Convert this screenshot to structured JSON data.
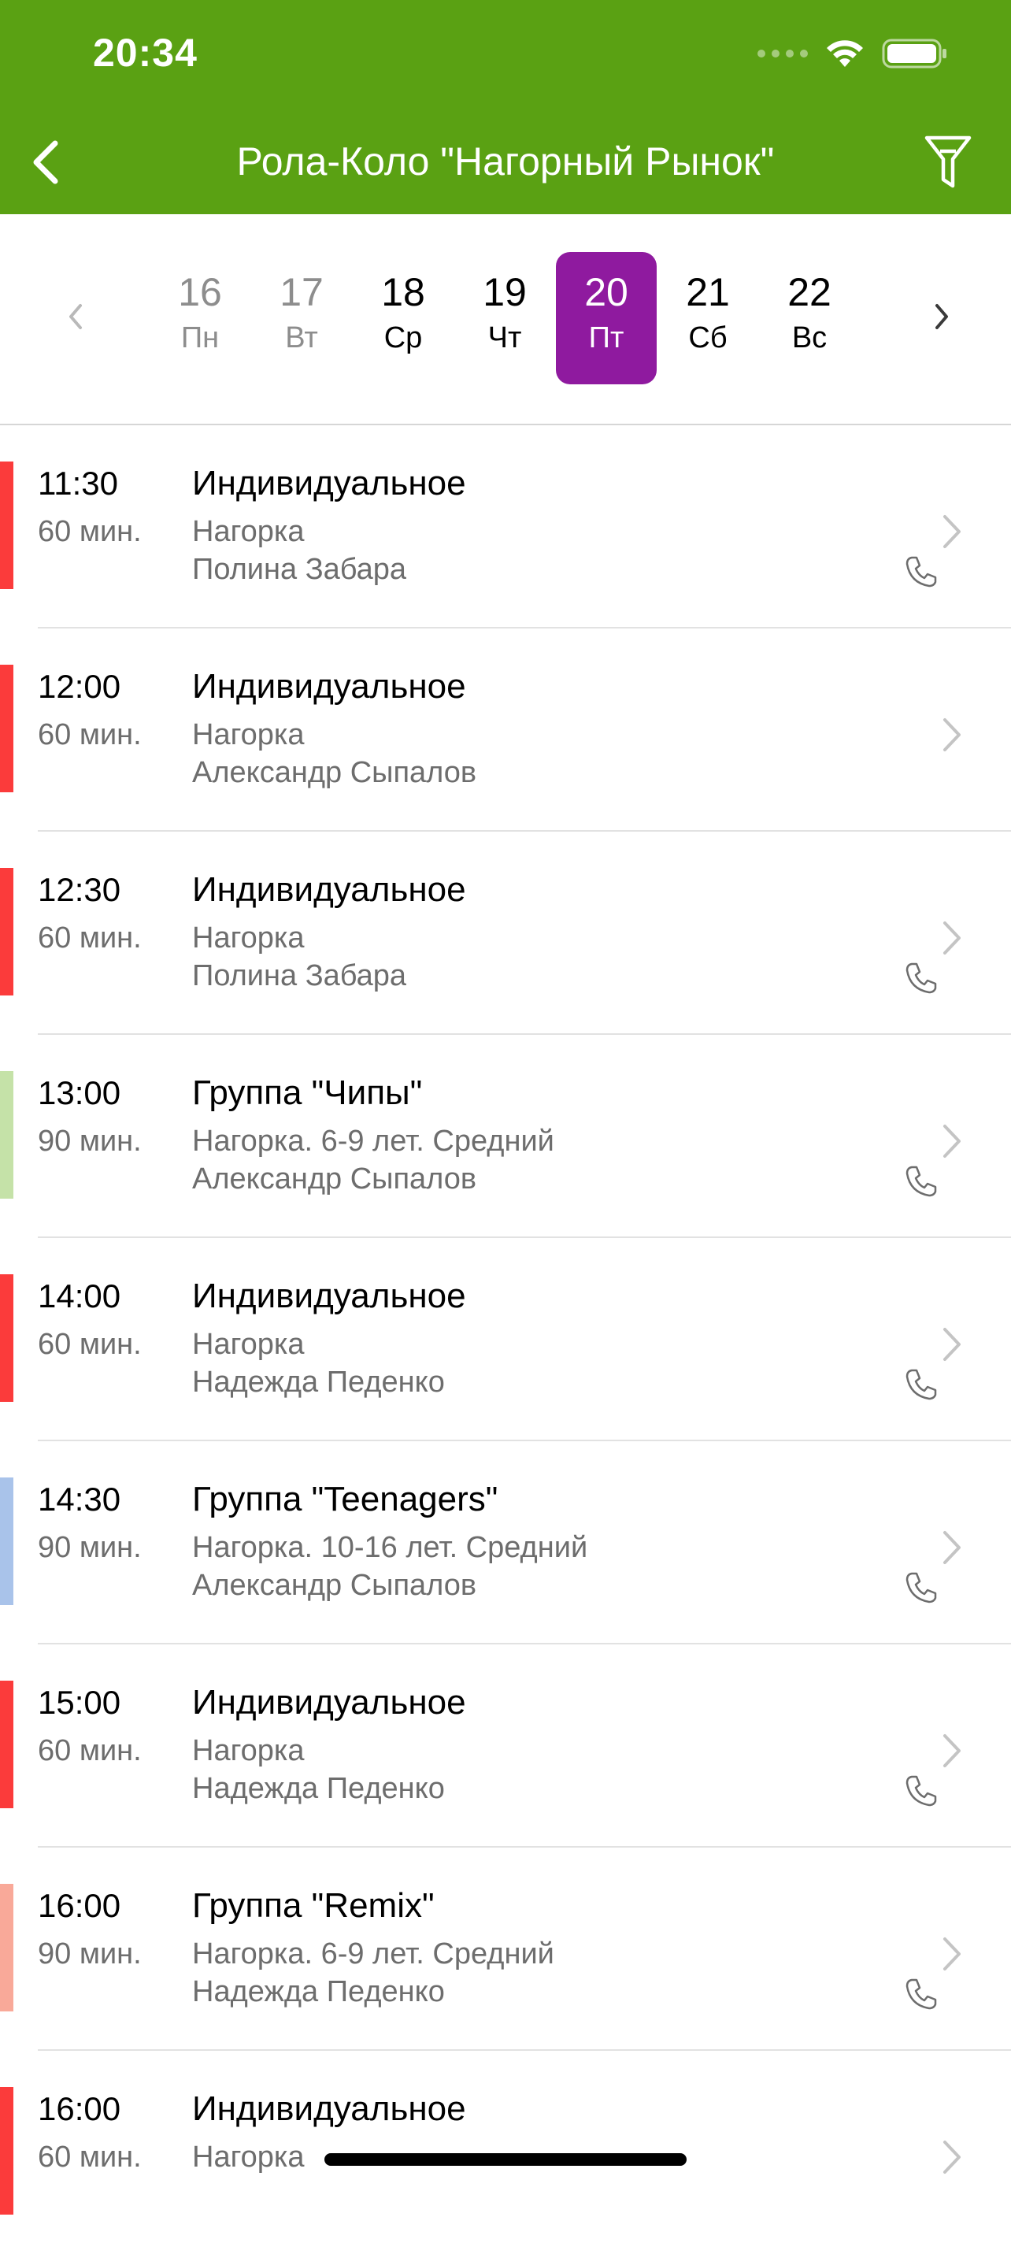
{
  "status_bar": {
    "time": "20:34"
  },
  "nav": {
    "title": "Рола-Коло \"Нагорный Рынок\"",
    "back_icon": "chevron-left-icon",
    "filter_icon": "filter-icon"
  },
  "week": {
    "days": [
      {
        "num": "16",
        "name": "Пн"
      },
      {
        "num": "17",
        "name": "Вт"
      },
      {
        "num": "18",
        "name": "Ср"
      },
      {
        "num": "19",
        "name": "Чт"
      },
      {
        "num": "20",
        "name": "Пт"
      },
      {
        "num": "21",
        "name": "Сб"
      },
      {
        "num": "22",
        "name": "Вс"
      }
    ],
    "selected_index": 4,
    "selected_color": "#8f1a9f"
  },
  "colors": {
    "header": "#5aa113",
    "stripe_individual": "#fb3b3b",
    "stripe_chips": "#c5e2a8",
    "stripe_teenagers": "#a9c3ea",
    "stripe_remix": "#f9a999"
  },
  "lessons": [
    {
      "time": "11:30",
      "duration": "60 мин.",
      "title": "Индивидуальное",
      "place": "Нагорка",
      "teacher": "Полина Забара",
      "has_phone": true
    },
    {
      "time": "12:00",
      "duration": "60 мин.",
      "title": "Индивидуальное",
      "place": "Нагорка",
      "teacher": "Александр Сыпалов",
      "has_phone": false
    },
    {
      "time": "12:30",
      "duration": "60 мин.",
      "title": "Индивидуальное",
      "place": "Нагорка",
      "teacher": "Полина Забара",
      "has_phone": true
    },
    {
      "time": "13:00",
      "duration": "90 мин.",
      "title": "Группа \"Чипы\"",
      "place": "Нагорка. 6-9 лет. Средний",
      "teacher": "Александр Сыпалов",
      "has_phone": true
    },
    {
      "time": "14:00",
      "duration": "60 мин.",
      "title": "Индивидуальное",
      "place": "Нагорка",
      "teacher": "Надежда Педенко",
      "has_phone": true
    },
    {
      "time": "14:30",
      "duration": "90 мин.",
      "title": "Группа \"Teenagers\"",
      "place": "Нагорка. 10-16 лет. Средний",
      "teacher": "Александр Сыпалов",
      "has_phone": true
    },
    {
      "time": "15:00",
      "duration": "60 мин.",
      "title": "Индивидуальное",
      "place": "Нагорка",
      "teacher": "Надежда Педенко",
      "has_phone": true
    },
    {
      "time": "16:00",
      "duration": "90 мин.",
      "title": "Группа \"Remix\"",
      "place": "Нагорка. 6-9 лет. Средний",
      "teacher": "Надежда Педенко",
      "has_phone": true
    },
    {
      "time": "16:00",
      "duration": "60 мин.",
      "title": "Индивидуальное",
      "place": "Нагорка",
      "teacher": "",
      "has_phone": false
    }
  ]
}
